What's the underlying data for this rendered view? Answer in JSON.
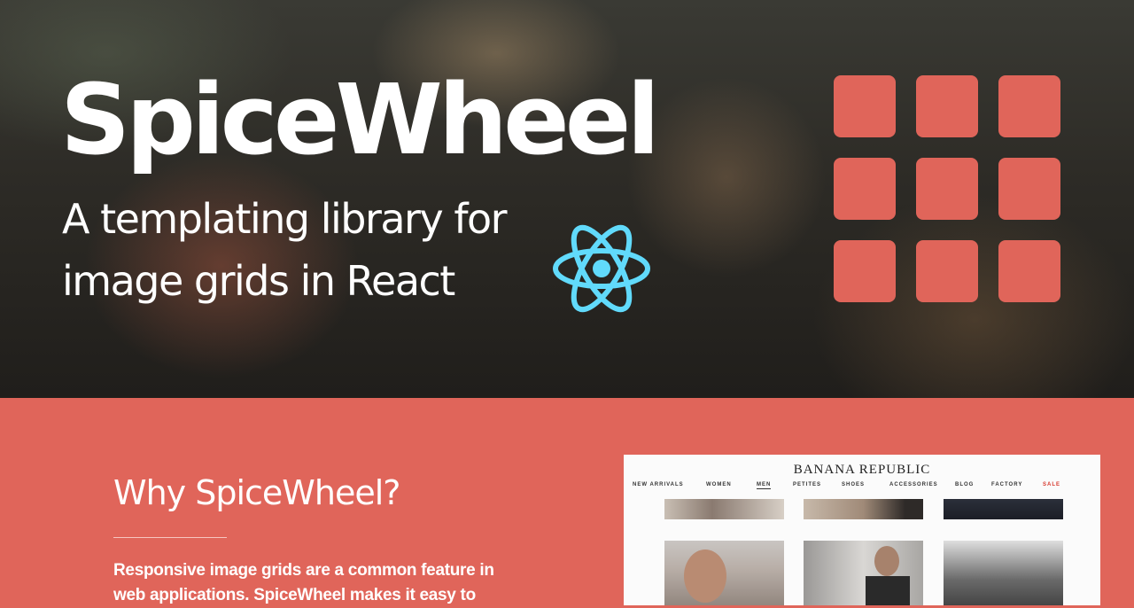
{
  "hero": {
    "title": "SpiceWheel",
    "subtitle": "A templating library for image grids in React"
  },
  "icons": {
    "react_logo": "react-atom-icon",
    "grid_logo": "grid-3x3-icon",
    "react_color": "#61dafb",
    "brand_color": "#e0655a"
  },
  "why": {
    "heading": "Why SpiceWheel?",
    "body": "Responsive image grids are a common feature in web applications. SpiceWheel makes it easy to"
  },
  "preview": {
    "brand": "BANANA REPUBLIC",
    "nav": [
      "NEW ARRIVALS",
      "WOMEN",
      "MEN",
      "PETITES",
      "SHOES",
      "ACCESSORIES",
      "BLOG",
      "FACTORY",
      "SALE"
    ],
    "active_nav": "MEN",
    "sale_color": "#d7392f"
  }
}
